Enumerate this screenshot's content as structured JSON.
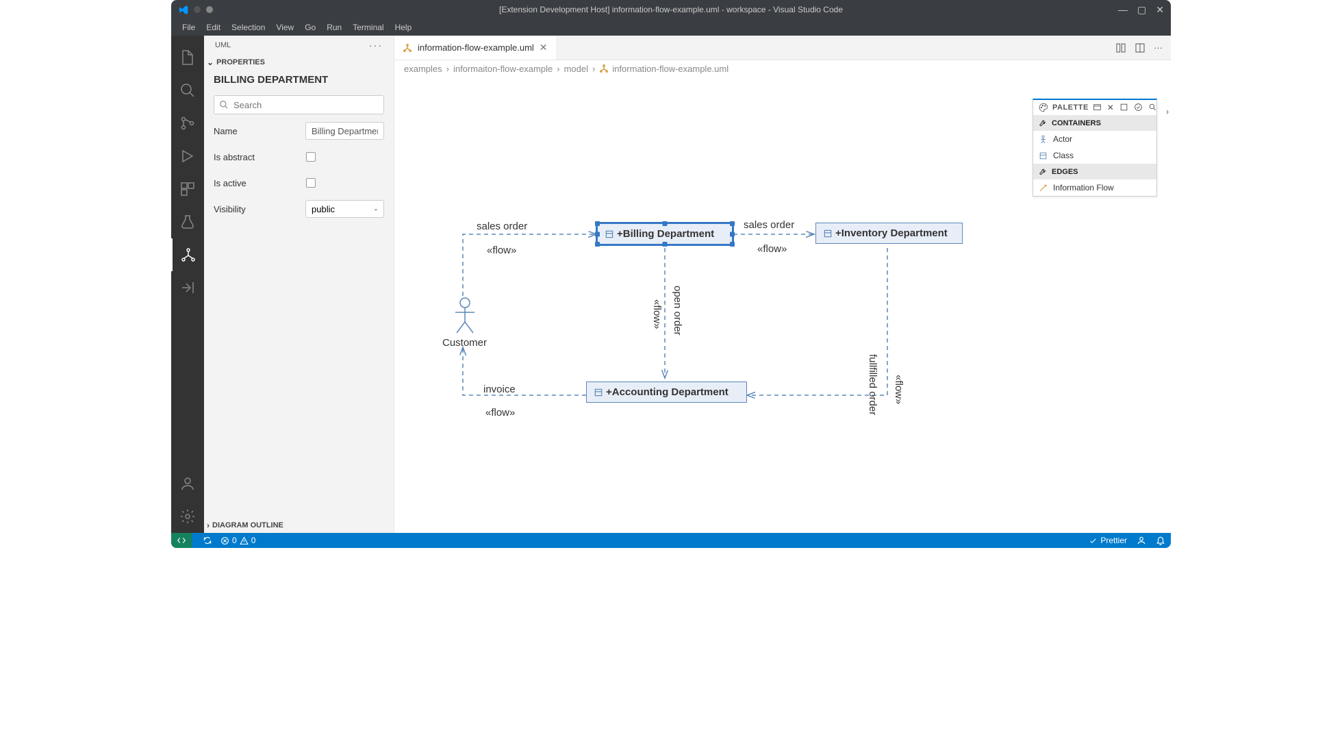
{
  "window": {
    "title": "[Extension Development Host] information-flow-example.uml - workspace - Visual Studio Code"
  },
  "menubar": {
    "items": [
      "File",
      "Edit",
      "Selection",
      "View",
      "Go",
      "Run",
      "Terminal",
      "Help"
    ]
  },
  "sidebar": {
    "title": "UML",
    "section_properties": "PROPERTIES",
    "section_outline": "DIAGRAM OUTLINE",
    "prop_title": "BILLING DEPARTMENT",
    "search_placeholder": "Search",
    "rows": {
      "name_label": "Name",
      "name_value": "Billing Departmen",
      "abstract_label": "Is abstract",
      "active_label": "Is active",
      "visibility_label": "Visibility",
      "visibility_value": "public"
    }
  },
  "tab": {
    "label": "information-flow-example.uml"
  },
  "breadcrumbs": {
    "items": [
      "examples",
      "informaiton-flow-example",
      "model"
    ],
    "file": "information-flow-example.uml"
  },
  "diagram": {
    "billing": "+Billing Department",
    "inventory": "+Inventory Department",
    "accounting": "+Accounting Department",
    "customer": "Customer",
    "flow_sales1": "sales order",
    "flow_sales2": "sales order",
    "flow_open": "open order",
    "flow_invoice": "invoice",
    "flow_fullfilled": "fullfilled order",
    "stereotype": "«flow»"
  },
  "palette": {
    "title": "PALETTE",
    "sections": {
      "containers": "CONTAINERS",
      "edges": "EDGES"
    },
    "items": {
      "actor": "Actor",
      "class": "Class",
      "info_flow": "Information Flow"
    }
  },
  "statusbar": {
    "errors": "0",
    "warnings": "0",
    "prettier": "Prettier"
  }
}
